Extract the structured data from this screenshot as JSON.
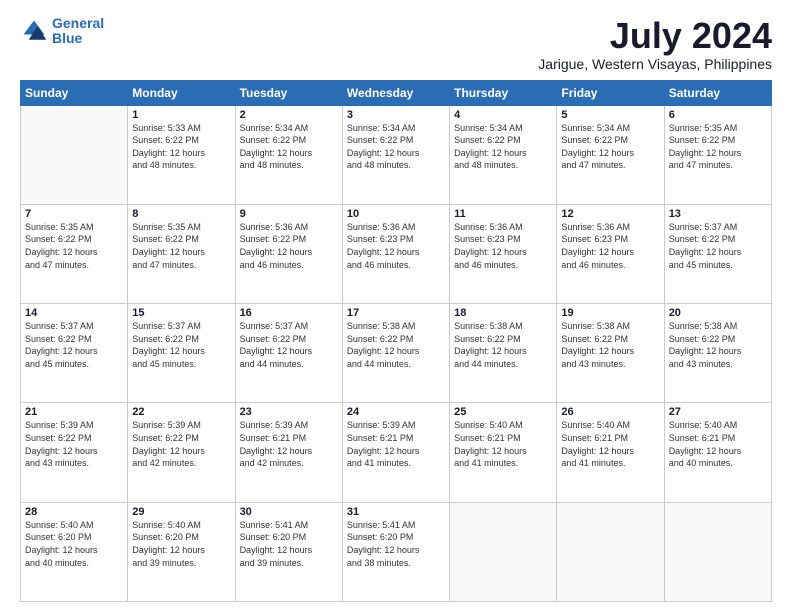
{
  "logo": {
    "line1": "General",
    "line2": "Blue"
  },
  "title": "July 2024",
  "subtitle": "Jarigue, Western Visayas, Philippines",
  "days_header": [
    "Sunday",
    "Monday",
    "Tuesday",
    "Wednesday",
    "Thursday",
    "Friday",
    "Saturday"
  ],
  "weeks": [
    [
      {
        "num": "",
        "info": ""
      },
      {
        "num": "1",
        "info": "Sunrise: 5:33 AM\nSunset: 6:22 PM\nDaylight: 12 hours\nand 48 minutes."
      },
      {
        "num": "2",
        "info": "Sunrise: 5:34 AM\nSunset: 6:22 PM\nDaylight: 12 hours\nand 48 minutes."
      },
      {
        "num": "3",
        "info": "Sunrise: 5:34 AM\nSunset: 6:22 PM\nDaylight: 12 hours\nand 48 minutes."
      },
      {
        "num": "4",
        "info": "Sunrise: 5:34 AM\nSunset: 6:22 PM\nDaylight: 12 hours\nand 48 minutes."
      },
      {
        "num": "5",
        "info": "Sunrise: 5:34 AM\nSunset: 6:22 PM\nDaylight: 12 hours\nand 47 minutes."
      },
      {
        "num": "6",
        "info": "Sunrise: 5:35 AM\nSunset: 6:22 PM\nDaylight: 12 hours\nand 47 minutes."
      }
    ],
    [
      {
        "num": "7",
        "info": "Sunrise: 5:35 AM\nSunset: 6:22 PM\nDaylight: 12 hours\nand 47 minutes."
      },
      {
        "num": "8",
        "info": "Sunrise: 5:35 AM\nSunset: 6:22 PM\nDaylight: 12 hours\nand 47 minutes."
      },
      {
        "num": "9",
        "info": "Sunrise: 5:36 AM\nSunset: 6:22 PM\nDaylight: 12 hours\nand 46 minutes."
      },
      {
        "num": "10",
        "info": "Sunrise: 5:36 AM\nSunset: 6:23 PM\nDaylight: 12 hours\nand 46 minutes."
      },
      {
        "num": "11",
        "info": "Sunrise: 5:36 AM\nSunset: 6:23 PM\nDaylight: 12 hours\nand 46 minutes."
      },
      {
        "num": "12",
        "info": "Sunrise: 5:36 AM\nSunset: 6:23 PM\nDaylight: 12 hours\nand 46 minutes."
      },
      {
        "num": "13",
        "info": "Sunrise: 5:37 AM\nSunset: 6:22 PM\nDaylight: 12 hours\nand 45 minutes."
      }
    ],
    [
      {
        "num": "14",
        "info": "Sunrise: 5:37 AM\nSunset: 6:22 PM\nDaylight: 12 hours\nand 45 minutes."
      },
      {
        "num": "15",
        "info": "Sunrise: 5:37 AM\nSunset: 6:22 PM\nDaylight: 12 hours\nand 45 minutes."
      },
      {
        "num": "16",
        "info": "Sunrise: 5:37 AM\nSunset: 6:22 PM\nDaylight: 12 hours\nand 44 minutes."
      },
      {
        "num": "17",
        "info": "Sunrise: 5:38 AM\nSunset: 6:22 PM\nDaylight: 12 hours\nand 44 minutes."
      },
      {
        "num": "18",
        "info": "Sunrise: 5:38 AM\nSunset: 6:22 PM\nDaylight: 12 hours\nand 44 minutes."
      },
      {
        "num": "19",
        "info": "Sunrise: 5:38 AM\nSunset: 6:22 PM\nDaylight: 12 hours\nand 43 minutes."
      },
      {
        "num": "20",
        "info": "Sunrise: 5:38 AM\nSunset: 6:22 PM\nDaylight: 12 hours\nand 43 minutes."
      }
    ],
    [
      {
        "num": "21",
        "info": "Sunrise: 5:39 AM\nSunset: 6:22 PM\nDaylight: 12 hours\nand 43 minutes."
      },
      {
        "num": "22",
        "info": "Sunrise: 5:39 AM\nSunset: 6:22 PM\nDaylight: 12 hours\nand 42 minutes."
      },
      {
        "num": "23",
        "info": "Sunrise: 5:39 AM\nSunset: 6:21 PM\nDaylight: 12 hours\nand 42 minutes."
      },
      {
        "num": "24",
        "info": "Sunrise: 5:39 AM\nSunset: 6:21 PM\nDaylight: 12 hours\nand 41 minutes."
      },
      {
        "num": "25",
        "info": "Sunrise: 5:40 AM\nSunset: 6:21 PM\nDaylight: 12 hours\nand 41 minutes."
      },
      {
        "num": "26",
        "info": "Sunrise: 5:40 AM\nSunset: 6:21 PM\nDaylight: 12 hours\nand 41 minutes."
      },
      {
        "num": "27",
        "info": "Sunrise: 5:40 AM\nSunset: 6:21 PM\nDaylight: 12 hours\nand 40 minutes."
      }
    ],
    [
      {
        "num": "28",
        "info": "Sunrise: 5:40 AM\nSunset: 6:20 PM\nDaylight: 12 hours\nand 40 minutes."
      },
      {
        "num": "29",
        "info": "Sunrise: 5:40 AM\nSunset: 6:20 PM\nDaylight: 12 hours\nand 39 minutes."
      },
      {
        "num": "30",
        "info": "Sunrise: 5:41 AM\nSunset: 6:20 PM\nDaylight: 12 hours\nand 39 minutes."
      },
      {
        "num": "31",
        "info": "Sunrise: 5:41 AM\nSunset: 6:20 PM\nDaylight: 12 hours\nand 38 minutes."
      },
      {
        "num": "",
        "info": ""
      },
      {
        "num": "",
        "info": ""
      },
      {
        "num": "",
        "info": ""
      }
    ]
  ]
}
